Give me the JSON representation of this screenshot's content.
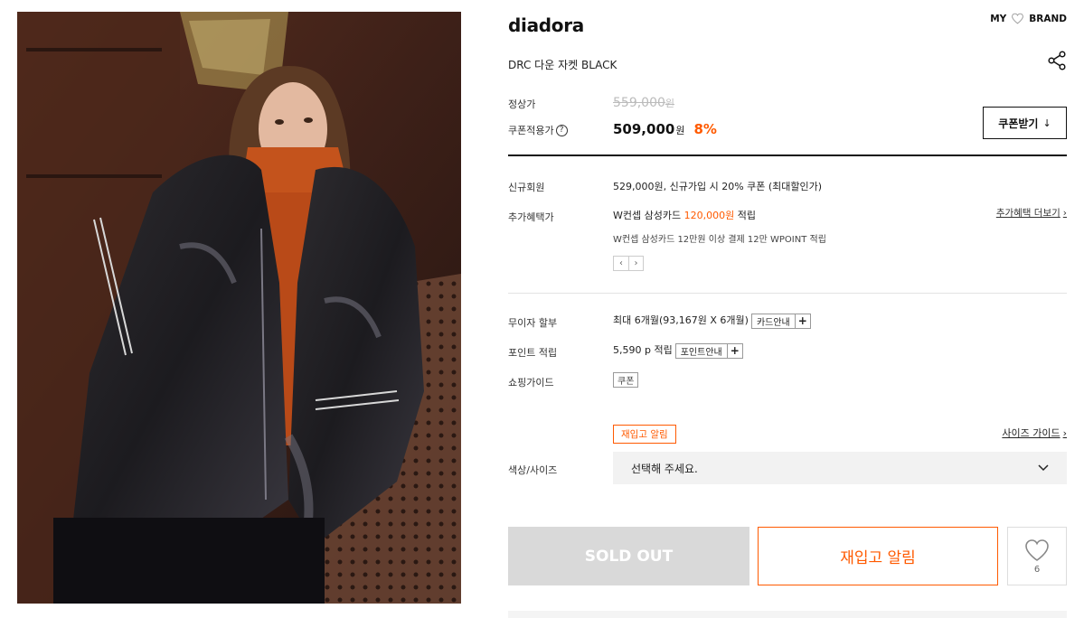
{
  "product": {
    "brand": "diadora",
    "name": "DRC 다운 자켓 BLACK"
  },
  "mybrand": {
    "my": "MY",
    "brand": "BRAND"
  },
  "price": {
    "regular_label": "정상가",
    "regular_value": "559,000",
    "regular_unit": "원",
    "coupon_label": "쿠폰적용가",
    "coupon_help": "?",
    "sale_value": "509,000",
    "sale_unit": "원",
    "discount_rate": "8%",
    "coupon_button": "쿠폰받기",
    "coupon_button_icon": "↓"
  },
  "benefits": {
    "new_member_label": "신규회원",
    "new_member_text": "529,000원, 신규가입 시 20% 쿠폰 (최대할인가)",
    "extra_label": "추가혜택가",
    "extra_prefix": "W컨셉 삼성카드",
    "extra_amount": "120,000원",
    "extra_suffix": "적립",
    "extra_note": "W컨셉 삼성카드 12만원 이상 결제 12만 WPOINT 적립",
    "more_link": "추가혜택 더보기",
    "more_icon": "›",
    "pager_prev": "‹",
    "pager_next": "›"
  },
  "installment": {
    "label": "무이자 할부",
    "text": "최대 6개월(93,167원 X 6개월)",
    "button": "카드안내",
    "plus": "+"
  },
  "points": {
    "label": "포인트 적립",
    "text": "5,590 p 적립",
    "button": "포인트안내",
    "plus": "+"
  },
  "guide": {
    "label": "쇼핑가이드",
    "tag": "쿠폰"
  },
  "options": {
    "restock_badge": "재입고 알림",
    "size_guide": "사이즈 가이드",
    "size_guide_icon": "›",
    "label": "색상/사이즈",
    "select_placeholder": "선택해 주세요."
  },
  "actions": {
    "soldout": "SOLD OUT",
    "restock": "재입고 알림",
    "wish_count": "6"
  },
  "colors": {
    "accent": "#ff5a00",
    "soldout_bg": "#d9d9d9",
    "select_bg": "#f2f2f2"
  }
}
